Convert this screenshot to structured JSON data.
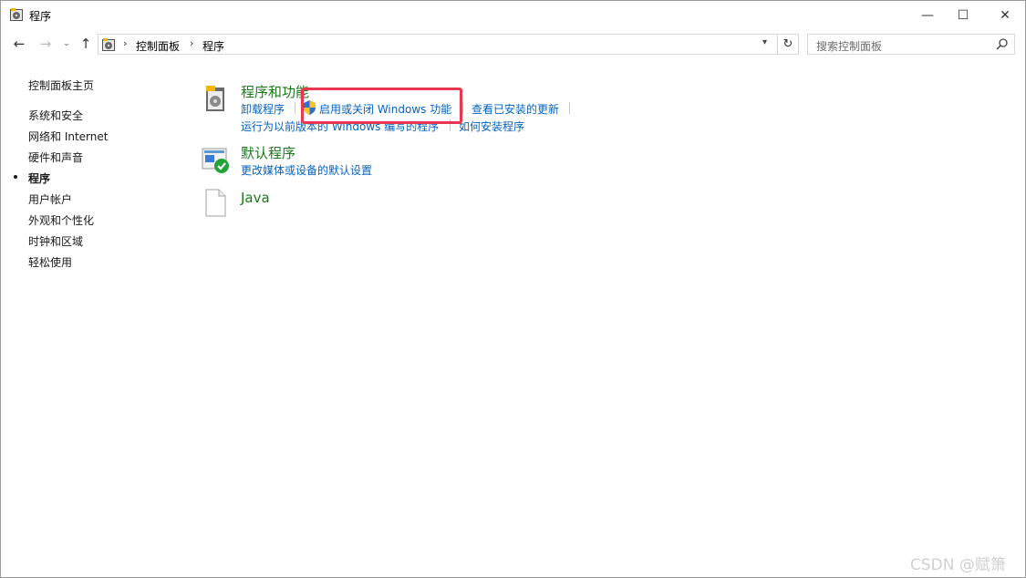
{
  "window": {
    "title": "程序",
    "controls": {
      "minimize": "—",
      "maximize": "☐",
      "close": "✕"
    }
  },
  "nav": {
    "back": "←",
    "forward": "→",
    "recent": "⌄",
    "up": "↑",
    "breadcrumb": [
      "控制面板",
      "程序"
    ],
    "refresh": "↻",
    "search_placeholder": "搜索控制面板"
  },
  "sidebar": {
    "home": "控制面板主页",
    "items": [
      {
        "label": "系统和安全",
        "selected": false
      },
      {
        "label": "网络和 Internet",
        "selected": false
      },
      {
        "label": "硬件和声音",
        "selected": false
      },
      {
        "label": "程序",
        "selected": true
      },
      {
        "label": "用户帐户",
        "selected": false
      },
      {
        "label": "外观和个性化",
        "selected": false
      },
      {
        "label": "时钟和区域",
        "selected": false
      },
      {
        "label": "轻松使用",
        "selected": false
      }
    ]
  },
  "sections": {
    "programs_features": {
      "title": "程序和功能",
      "links": [
        "卸载程序",
        "启用或关闭 Windows 功能",
        "查看已安装的更新",
        "运行为以前版本的 Windows 编写的程序",
        "如何安装程序"
      ]
    },
    "default_programs": {
      "title": "默认程序",
      "links": [
        "更改媒体或设备的默认设置"
      ]
    },
    "java": {
      "title": "Java"
    }
  },
  "colors": {
    "section_title": "#1b7a1b",
    "link": "#0563c1",
    "highlight_box": "#e8384f"
  },
  "watermark": "CSDN @赋箫"
}
